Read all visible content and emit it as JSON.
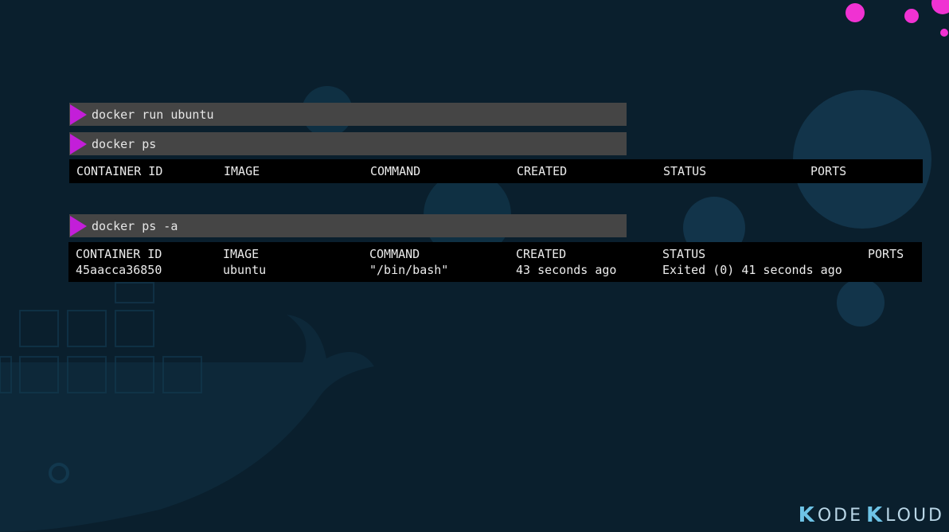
{
  "commands": [
    {
      "prompt_icon": "play-triangle-icon",
      "text": "docker run ubuntu"
    },
    {
      "prompt_icon": "play-triangle-icon",
      "text": "docker ps"
    },
    {
      "prompt_icon": "play-triangle-icon",
      "text": "docker ps -a"
    }
  ],
  "ps_output": {
    "headers": [
      "CONTAINER ID",
      "IMAGE",
      "COMMAND",
      "CREATED",
      "STATUS",
      "PORTS"
    ]
  },
  "ps_a_output": {
    "headers": [
      "CONTAINER ID",
      "IMAGE",
      "COMMAND",
      "CREATED",
      "STATUS",
      "PORTS"
    ],
    "rows": [
      [
        "45aacca36850",
        "ubuntu",
        "\"/bin/bash\"",
        "43 seconds ago",
        "Exited (0) 41 seconds ago",
        ""
      ]
    ]
  },
  "logo": {
    "part1": "ODE",
    "part2": "LOUD",
    "mark": "K"
  },
  "colors": {
    "background": "#0a1f2d",
    "prompt_accent": "#c31ed9",
    "bar": "#454545",
    "decor_pink": "#f032d2",
    "decor_blue": "#12344a"
  }
}
